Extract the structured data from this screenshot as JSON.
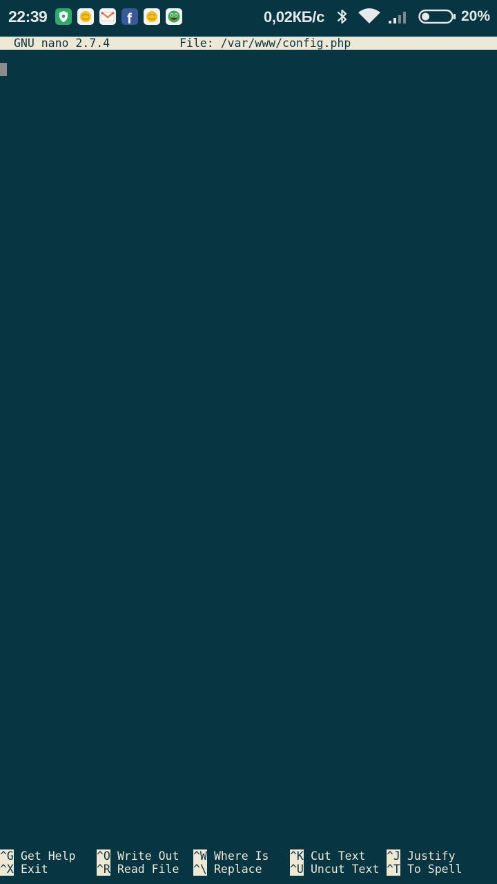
{
  "status_bar": {
    "time": "22:39",
    "net_speed": "0,02КБ/с",
    "battery_percent": "20%",
    "battery_level": 0.2,
    "notification_icons": [
      "shield-icon",
      "emoji-icon",
      "mail-icon",
      "facebook-icon",
      "emoji-icon",
      "face-icon"
    ],
    "system_icons": [
      "bluetooth-icon",
      "wifi-icon",
      "cell-signal-icon",
      "battery-icon"
    ]
  },
  "editor": {
    "version": "GNU nano 2.7.4",
    "file_label": "File: /var/www/config.php",
    "content": ""
  },
  "shortcuts": {
    "row1": [
      {
        "key": "^G",
        "label": "Get Help"
      },
      {
        "key": "^O",
        "label": "Write Out"
      },
      {
        "key": "^W",
        "label": "Where Is"
      },
      {
        "key": "^K",
        "label": "Cut Text"
      },
      {
        "key": "^J",
        "label": "Justify"
      }
    ],
    "row2": [
      {
        "key": "^X",
        "label": "Exit"
      },
      {
        "key": "^R",
        "label": "Read File"
      },
      {
        "key": "^\\",
        "label": "Replace"
      },
      {
        "key": "^U",
        "label": "Uncut Text"
      },
      {
        "key": "^T",
        "label": "To Spell"
      }
    ]
  },
  "colors": {
    "background": "#073642",
    "foreground": "#eee8d5",
    "cursor": "#8c8c8c"
  }
}
